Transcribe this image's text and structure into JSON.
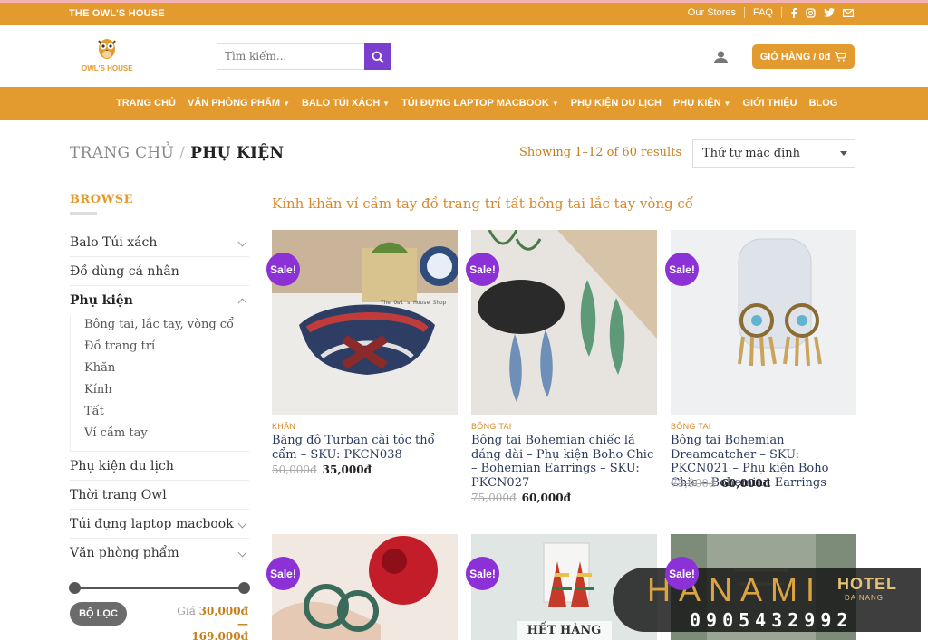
{
  "topbar": {
    "brand": "THE OWL'S HOUSE",
    "links": [
      "Our Stores",
      "FAQ"
    ],
    "social_icons": [
      "facebook-icon",
      "instagram-icon",
      "twitter-icon",
      "email-icon"
    ]
  },
  "header": {
    "logo_text": "OWL'S HOUSE",
    "search_placeholder": "Tìm kiếm...",
    "cart_label": "GIỎ HÀNG / 0đ"
  },
  "nav": {
    "items": [
      {
        "label": "TRANG CHỦ",
        "dropdown": false
      },
      {
        "label": "VĂN PHÒNG PHẨM",
        "dropdown": true
      },
      {
        "label": "BALO TÚI XÁCH",
        "dropdown": true
      },
      {
        "label": "TÚI ĐỰNG LAPTOP MACBOOK",
        "dropdown": true
      },
      {
        "label": "PHỤ KIỆN DU LỊCH",
        "dropdown": false
      },
      {
        "label": "PHỤ KIỆN",
        "dropdown": true
      },
      {
        "label": "GIỚI THIỆU",
        "dropdown": false
      },
      {
        "label": "BLOG",
        "dropdown": false
      }
    ]
  },
  "breadcrumb": {
    "home": "TRANG CHỦ",
    "separator": "/",
    "current": "PHỤ KIỆN"
  },
  "results": {
    "showing": "Showing 1–12 of 60 results",
    "sort_selected": "Thứ tự mặc định"
  },
  "sidebar": {
    "title": "BROWSE",
    "categories": [
      {
        "label": "Balo Túi xách",
        "expandable": true
      },
      {
        "label": "Đồ dùng cá nhân",
        "expandable": false
      },
      {
        "label": "Phụ kiện",
        "expandable": true,
        "active": true
      }
    ],
    "subcategories": [
      "Bông tai, lắc tay, vòng cổ",
      "Đồ trang trí",
      "Khăn",
      "Kính",
      "Tất",
      "Ví cầm tay"
    ],
    "more_categories": [
      {
        "label": "Phụ kiện du lịch",
        "expandable": false
      },
      {
        "label": "Thời trang Owl",
        "expandable": false
      },
      {
        "label": "Túi đựng laptop macbook",
        "expandable": true
      },
      {
        "label": "Văn phòng phẩm",
        "expandable": true
      }
    ],
    "filter_button": "BỘ LỌC",
    "price_prefix": "Giá",
    "price_min": "30,000đ",
    "price_dash": "—",
    "price_max": "169,000đ"
  },
  "category_description": "Kính khăn ví cầm tay đồ trang trí tất bông tai lắc tay vòng cổ",
  "products": [
    {
      "sale": "Sale!",
      "category": "KHĂN",
      "name": "Băng đô Turban cài tóc thổ cẩm – SKU: PKCN038",
      "old_price": "50,000đ",
      "price": "35,000đ"
    },
    {
      "sale": "Sale!",
      "category": "BÔNG TAI",
      "name": "Bông tai Bohemian chiếc lá dáng dài – Phụ kiện Boho Chic – Bohemian Earrings – SKU: PKCN027",
      "old_price": "75,000đ",
      "price": "60,000đ"
    },
    {
      "sale": "Sale!",
      "category": "BÔNG TAI",
      "name": "Bông tai Bohemian Dreamcatcher – SKU: PKCN021 – Phụ kiện Boho Chic – Bohemian Earrings",
      "old_price": "75,000đ",
      "price": "60,000đ"
    },
    {
      "sale": "Sale!"
    },
    {
      "sale": "Sale!",
      "out_of_stock": "HẾT HÀNG"
    },
    {
      "sale": "Sale!"
    }
  ],
  "watermark": {
    "brand": "HANAMI",
    "hotel": "HOTEL",
    "city": "DA NANG",
    "phone": "0905432992"
  },
  "colors": {
    "accent": "#e39b2f",
    "sale_badge": "#8b31d6",
    "search_button": "#7a3fcf"
  }
}
